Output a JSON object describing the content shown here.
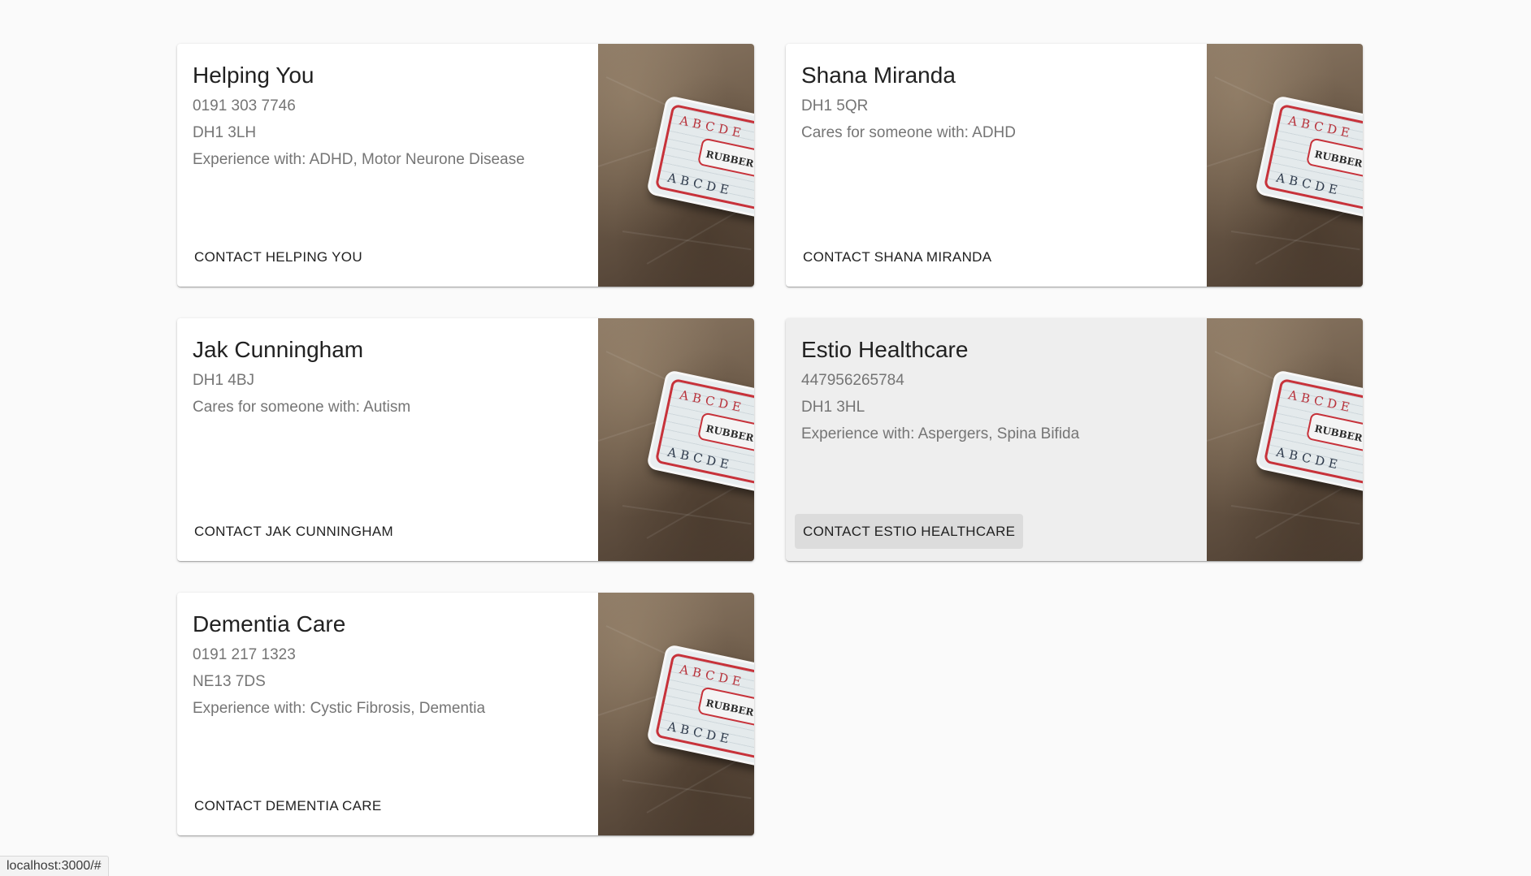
{
  "cards": [
    {
      "title": "Helping You",
      "lines": [
        "0191 303 7746",
        "DH1 3LH",
        "Experience with: ADHD, Motor Neurone Disease"
      ],
      "button": "CONTACT HELPING YOU",
      "image_icon": "rubber-stamp-box-image"
    },
    {
      "title": "Shana Miranda",
      "lines": [
        "DH1 5QR",
        "Cares for someone with: ADHD"
      ],
      "button": "CONTACT SHANA MIRANDA",
      "image_icon": "rubber-stamp-box-image"
    },
    {
      "title": "Jak Cunningham",
      "lines": [
        "DH1 4BJ",
        "Cares for someone with: Autism"
      ],
      "button": "CONTACT JAK CUNNINGHAM",
      "image_icon": "rubber-stamp-box-image"
    },
    {
      "title": "Estio Healthcare",
      "lines": [
        "447956265784",
        "DH1 3HL",
        "Experience with: Aspergers, Spina Bifida"
      ],
      "button": "CONTACT ESTIO HEALTHCARE",
      "image_icon": "rubber-stamp-box-image",
      "state": "hovered"
    },
    {
      "title": "Dementia Care",
      "lines": [
        "0191 217 1323",
        "NE13 7DS",
        "Experience with: Cystic Fibrosis, Dementia"
      ],
      "button": "CONTACT DEMENTIA CARE",
      "image_icon": "rubber-stamp-box-image"
    }
  ],
  "media": {
    "stamp_label": "RUBBER S",
    "letters_top": "ABCDE",
    "letters_bottom": "ABCDE"
  },
  "status_bar": {
    "url": "localhost:3000/#"
  },
  "colors": {
    "background": "#fafafa",
    "card": "#ffffff",
    "card_hover": "#eeeeee",
    "title_text": "#212121",
    "secondary_text": "#757575"
  }
}
